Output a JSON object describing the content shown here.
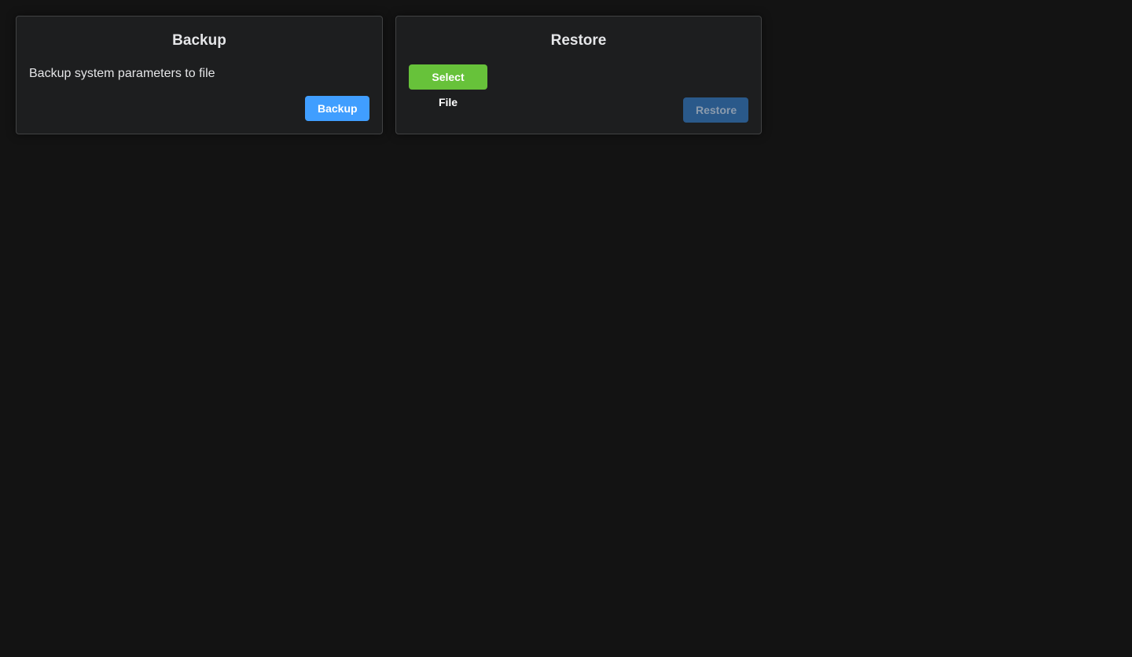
{
  "backup_card": {
    "title": "Backup",
    "description": "Backup system parameters to file",
    "button_label": "Backup"
  },
  "restore_card": {
    "title": "Restore",
    "select_file_label": "Select File",
    "restore_button_label": "Restore",
    "restore_button_disabled": true
  },
  "colors": {
    "background": "#131313",
    "card_background": "#1d1e1f",
    "card_border": "#414243",
    "primary": "#409eff",
    "success": "#67c23a",
    "primary_disabled": "#2a598a",
    "text": "#e5e6e8"
  }
}
